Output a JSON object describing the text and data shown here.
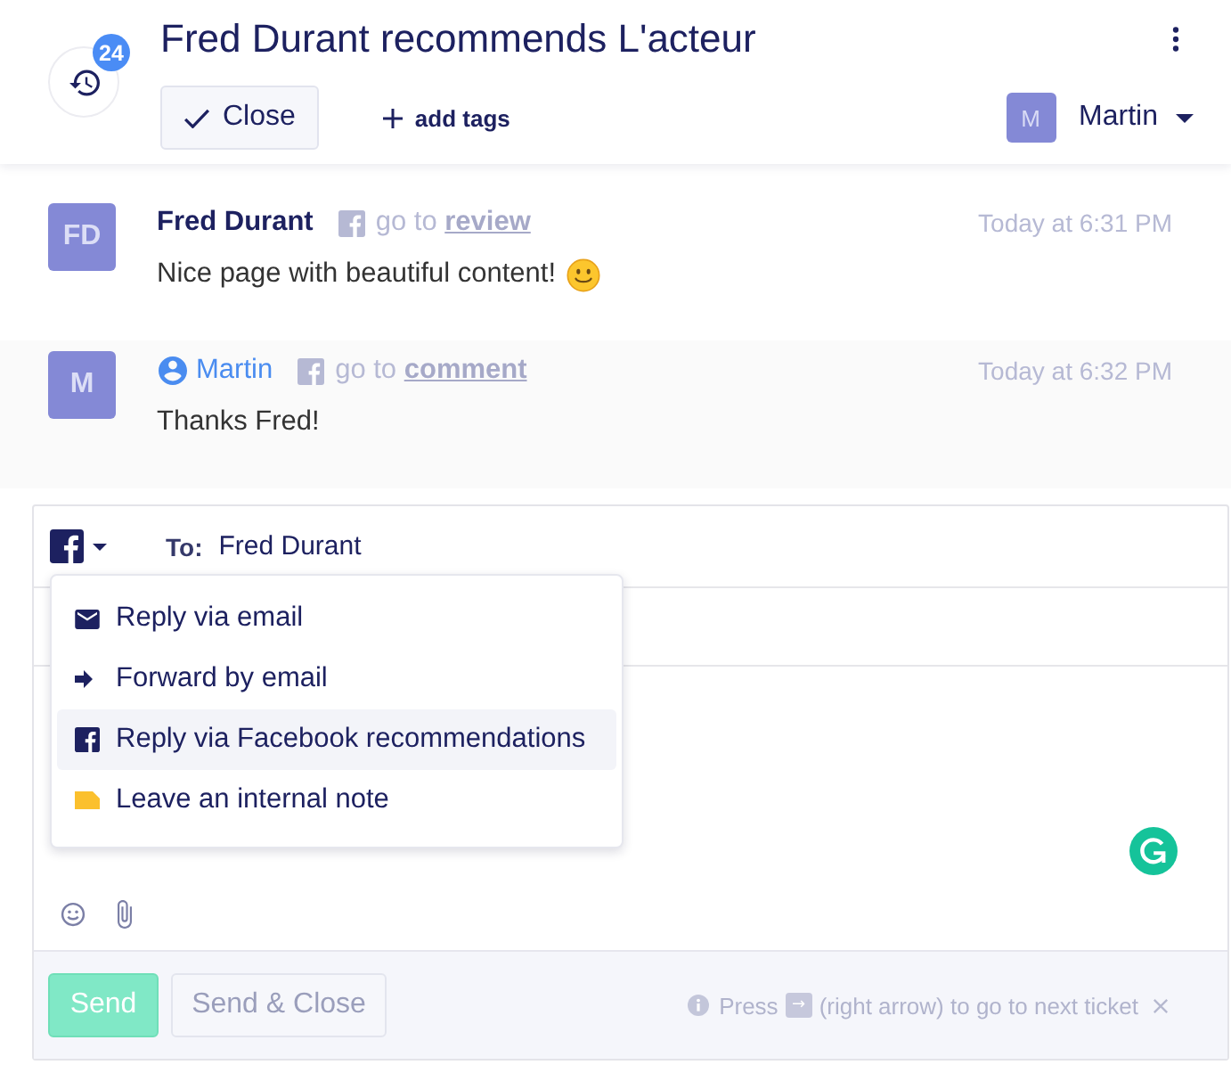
{
  "header": {
    "badge": "24",
    "title": "Fred Durant recommends L'acteur",
    "close_label": "Close",
    "add_tags_label": "add tags",
    "assignee": {
      "initials": "M",
      "name": "Martin"
    }
  },
  "messages": [
    {
      "kind": "customer",
      "initials": "FD",
      "author": "Fred Durant",
      "source_text": "go to",
      "source_link": "review",
      "time": "Today at 6:31 PM",
      "text": "Nice page with beautiful content!",
      "emoji": true
    },
    {
      "kind": "agent",
      "initials": "M",
      "author": "Martin",
      "source_text": "go to",
      "source_link": "comment",
      "time": "Today at 6:32 PM",
      "text": "Thanks Fred!",
      "emoji": false
    }
  ],
  "composer": {
    "channel_menu_open": true,
    "to_label": "To:",
    "to_value": "Fred Durant",
    "channel_options": [
      {
        "kind": "email",
        "label": "Reply via email",
        "selected": false
      },
      {
        "kind": "forward",
        "label": "Forward by email",
        "selected": false
      },
      {
        "kind": "facebook",
        "label": "Reply via Facebook recommendations",
        "selected": true
      },
      {
        "kind": "note",
        "label": "Leave an internal note",
        "selected": false
      }
    ]
  },
  "footer": {
    "buttons": [
      {
        "kind": "primary",
        "label": "Send"
      },
      {
        "kind": "secondary",
        "label": "Send & Close"
      }
    ],
    "hint": {
      "before": "Press",
      "key": "→",
      "after": "(right arrow) to go to next ticket"
    }
  }
}
